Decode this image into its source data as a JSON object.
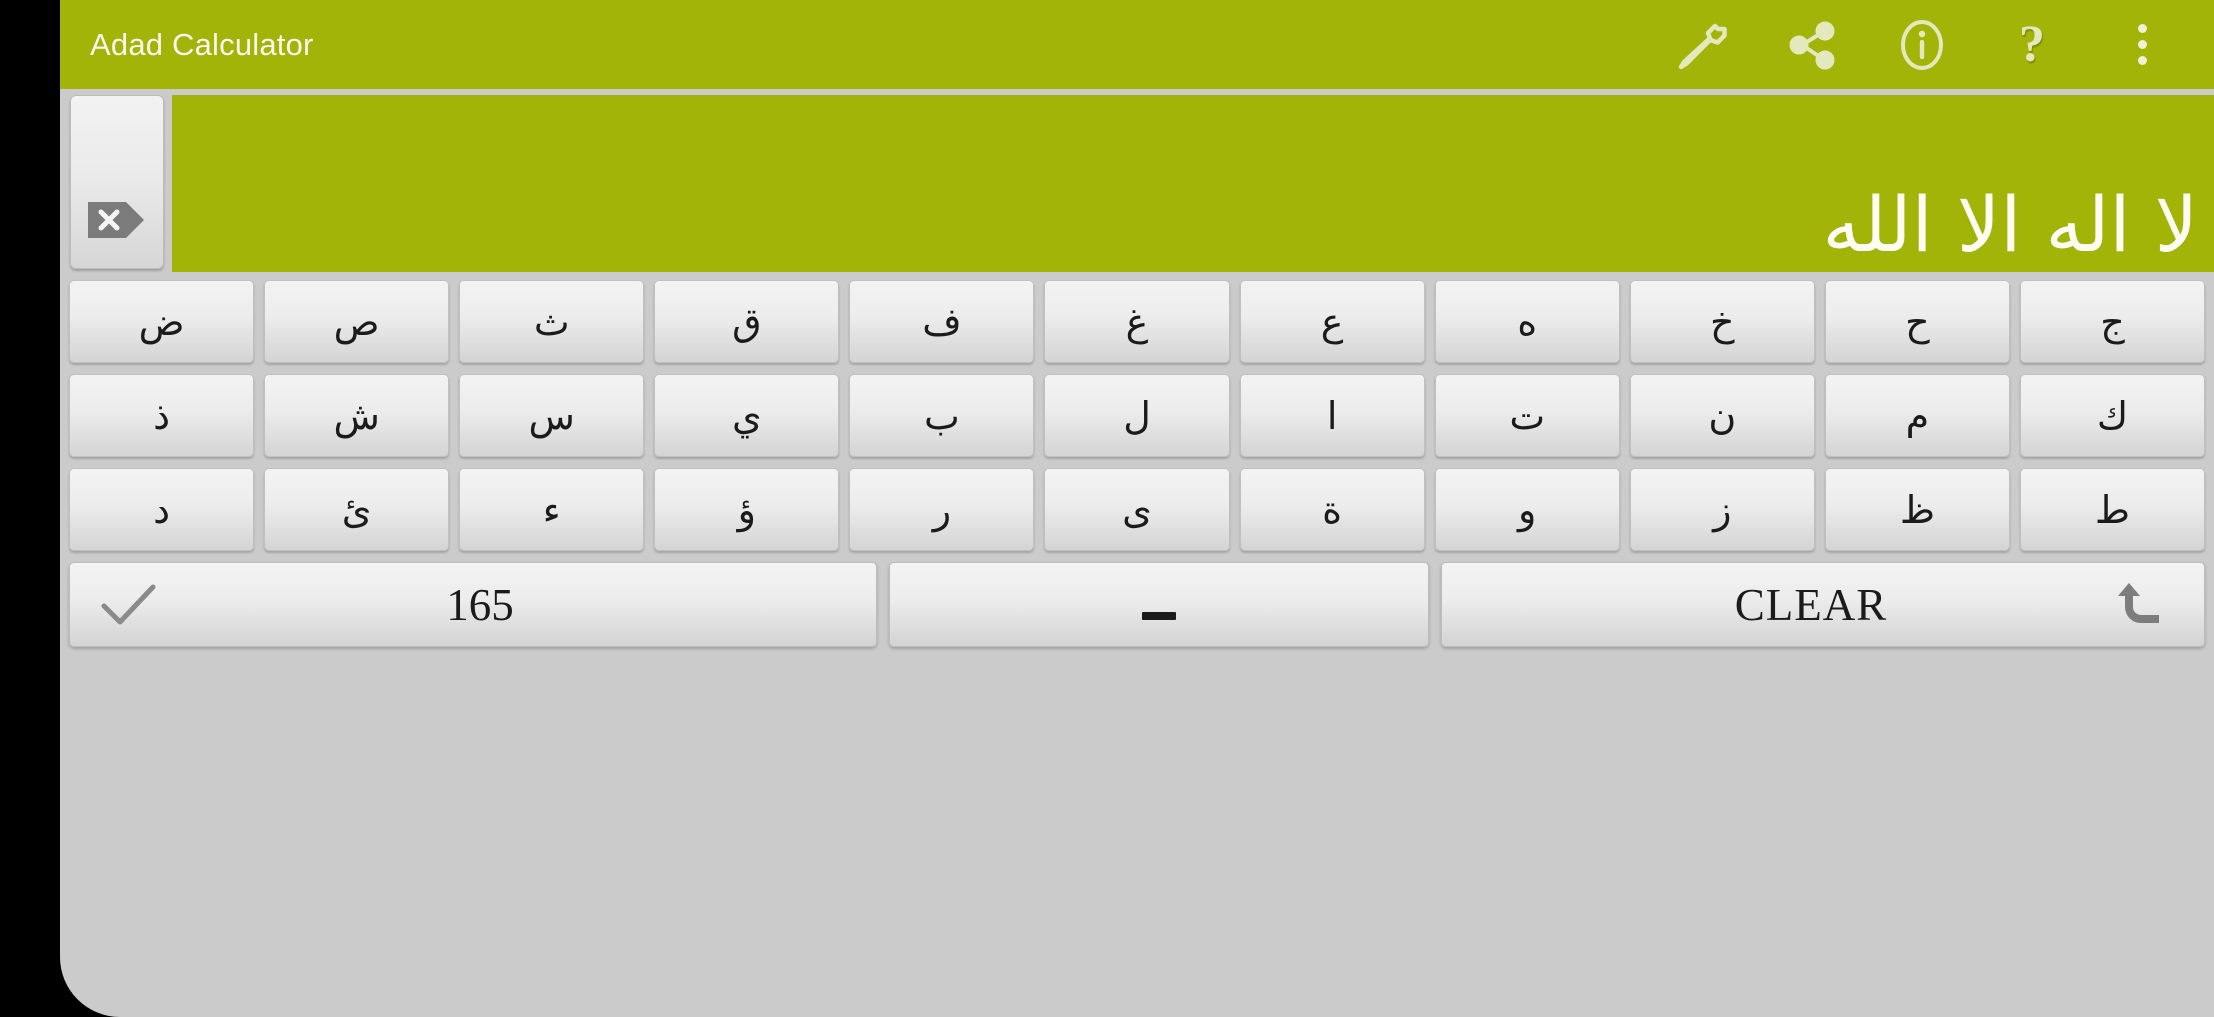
{
  "app": {
    "title": "Adad Calculator",
    "accent_color": "#a2b408",
    "key_face_color": "#ececec",
    "text_color": "#1b1b1b"
  },
  "toolbar": {
    "actions": [
      {
        "name": "settings",
        "icon": "wrench-icon",
        "label": ""
      },
      {
        "name": "share",
        "icon": "share-icon",
        "label": ""
      },
      {
        "name": "info",
        "icon": "info-icon",
        "label": ""
      },
      {
        "name": "help",
        "icon": "question-mark-icon",
        "label": "?"
      },
      {
        "name": "overflow",
        "icon": "more-vertical-icon",
        "label": ""
      }
    ]
  },
  "display": {
    "value": "لا اله الا الله",
    "delete_icon": "backspace-icon"
  },
  "keyboard": {
    "rows": [
      [
        "ض",
        "ص",
        "ث",
        "ق",
        "ف",
        "غ",
        "ع",
        "ه",
        "خ",
        "ح",
        "ج"
      ],
      [
        "ذ",
        "ش",
        "س",
        "ي",
        "ب",
        "ل",
        "ا",
        "ت",
        "ن",
        "م",
        "ك"
      ],
      [
        "د",
        "ئ",
        "ء",
        "ؤ",
        "ر",
        "ى",
        "ة",
        "و",
        "ز",
        "ظ",
        "ط"
      ]
    ],
    "bottom": {
      "result_value": "165",
      "result_icon": "check-icon",
      "space_label": "_",
      "space_icon": "space-bar-icon",
      "clear_label": "CLEAR",
      "clear_icon": "undo-arrow-icon"
    }
  }
}
